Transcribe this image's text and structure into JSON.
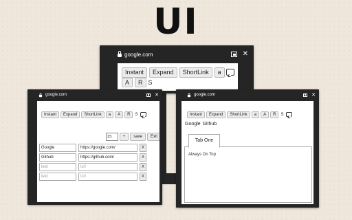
{
  "title": "UI",
  "toolbar": {
    "buttons": [
      "Instant",
      "Expand",
      "ShortLink",
      "a",
      "A",
      "R"
    ],
    "plain_label": "S",
    "chat_icon": "chat-bubble-icon"
  },
  "window_top": {
    "domain": "google.com",
    "toolbar_buttons": [
      "Instant",
      "Expand",
      "ShortLink",
      "a"
    ],
    "toolbar_row2": [
      "A",
      "R"
    ],
    "plain_label": "S"
  },
  "window_left": {
    "domain": "google.com",
    "stepper": {
      "value": "15",
      "increment_label": "+",
      "save_label": "save",
      "exit_label": "Exit"
    },
    "rows": [
      {
        "name": "Google",
        "url": "https://google.com/",
        "placeholder": false
      },
      {
        "name": "Github",
        "url": "https://github.com/",
        "placeholder": false
      },
      {
        "name": "text",
        "url": "Url",
        "placeholder": true
      },
      {
        "name": "text",
        "url": "Url",
        "placeholder": true
      }
    ],
    "delete_label": "X"
  },
  "window_right": {
    "domain": "google.com",
    "links": [
      "Google",
      "Github"
    ],
    "tab_label": "Tab One",
    "tab_content": "Always On Top"
  },
  "icons": {
    "close": "close-icon",
    "pip": "picture-in-picture-icon",
    "lock": "lock-icon"
  },
  "colors": {
    "window_frame": "#252525",
    "background": "#efe7dc",
    "content": "#ffffff"
  }
}
